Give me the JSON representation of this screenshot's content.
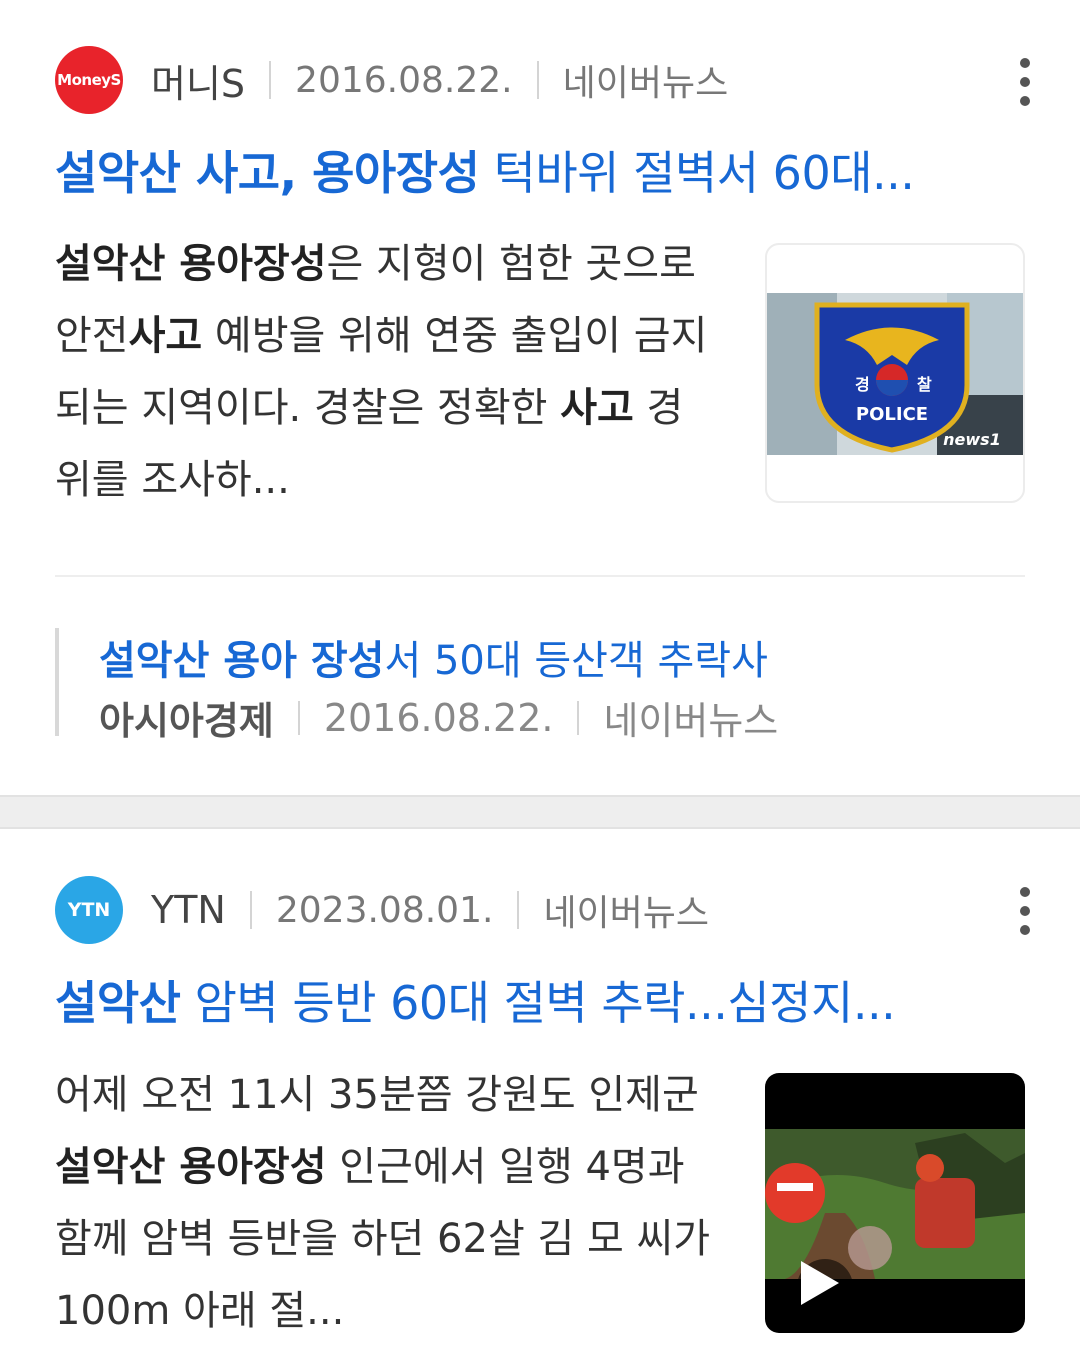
{
  "cards": [
    {
      "press_logo_text": "MoneyS",
      "press_name": "머니S",
      "date": "2016.08.22.",
      "source": "네이버뉴스",
      "title_bold": "설악산 사고, 용아장성",
      "title_rest": " 턱바위 절벽서 60대...",
      "desc_parts": [
        {
          "text": "설악산 용아장성",
          "bold": true
        },
        {
          "text": "은 지형이 험한 곳으로 안전",
          "bold": false
        },
        {
          "text": "사고",
          "bold": true
        },
        {
          "text": " 예방을 위해 연중 출입이 금지되는 지역이다. 경찰은 정확한 ",
          "bold": false
        },
        {
          "text": "사고",
          "bold": true
        },
        {
          "text": " 경위를 조사하...",
          "bold": false
        }
      ],
      "thumbnail": {
        "badge_top": "경",
        "badge_top2": "찰",
        "badge_text": "POLICE",
        "watermark": "news1"
      },
      "related": {
        "title_bold": "설악산 용아 장성",
        "title_rest": "서 50대 등산객 추락사",
        "press": "아시아경제",
        "date": "2016.08.22.",
        "source": "네이버뉴스"
      }
    },
    {
      "press_logo_text": "YTN",
      "press_name": "YTN",
      "date": "2023.08.01.",
      "source": "네이버뉴스",
      "title_bold": "설악산",
      "title_rest": " 암벽 등반 60대 절벽 추락...심정지...",
      "desc_parts": [
        {
          "text": "어제 오전 11시 35분쯤 강원도 인제군 ",
          "bold": false
        },
        {
          "text": "설악산 용아장성",
          "bold": true
        },
        {
          "text": " 인근에서 일행 4명과 함께 암벽 등반을 하던 62살 김 모 씨가 100m 아래 절...",
          "bold": false
        }
      ]
    }
  ],
  "colors": {
    "title": "#1768d4",
    "moneys_red": "#e8232b",
    "ytn_blue": "#2aa6e6"
  },
  "icons": [
    "more-vertical-icon",
    "play-icon"
  ]
}
